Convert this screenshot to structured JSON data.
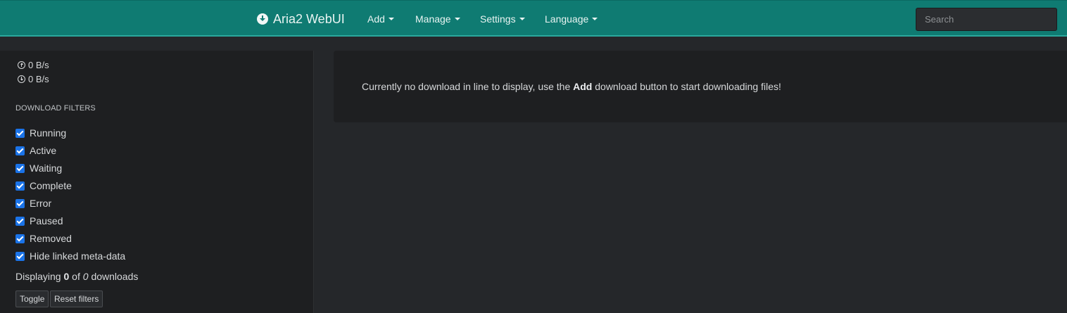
{
  "navbar": {
    "brand": "Aria2 WebUI",
    "menus": [
      "Add",
      "Manage",
      "Settings",
      "Language"
    ],
    "search_placeholder": "Search"
  },
  "sidebar": {
    "upload_speed": "0 B/s",
    "download_speed": "0 B/s",
    "filters_heading": "DOWNLOAD FILTERS",
    "filters": [
      {
        "label": "Running",
        "checked": true
      },
      {
        "label": "Active",
        "checked": true
      },
      {
        "label": "Waiting",
        "checked": true
      },
      {
        "label": "Complete",
        "checked": true
      },
      {
        "label": "Error",
        "checked": true
      },
      {
        "label": "Paused",
        "checked": true
      },
      {
        "label": "Removed",
        "checked": true
      },
      {
        "label": "Hide linked meta-data",
        "checked": true
      }
    ],
    "displaying": {
      "prefix": "Displaying",
      "shown": "0",
      "of": "of",
      "total": "0",
      "suffix": "downloads"
    },
    "toggle_label": "Toggle",
    "reset_label": "Reset filters"
  },
  "main": {
    "empty_prefix": "Currently no download in line to display, use the",
    "empty_bold": "Add",
    "empty_suffix": "download button to start downloading files!"
  },
  "colors": {
    "navbar": "#0f7b72",
    "accent_border": "#2aa89c",
    "background": "#25272a",
    "panel": "#1e1f21",
    "checkbox": "#1a73e8"
  }
}
